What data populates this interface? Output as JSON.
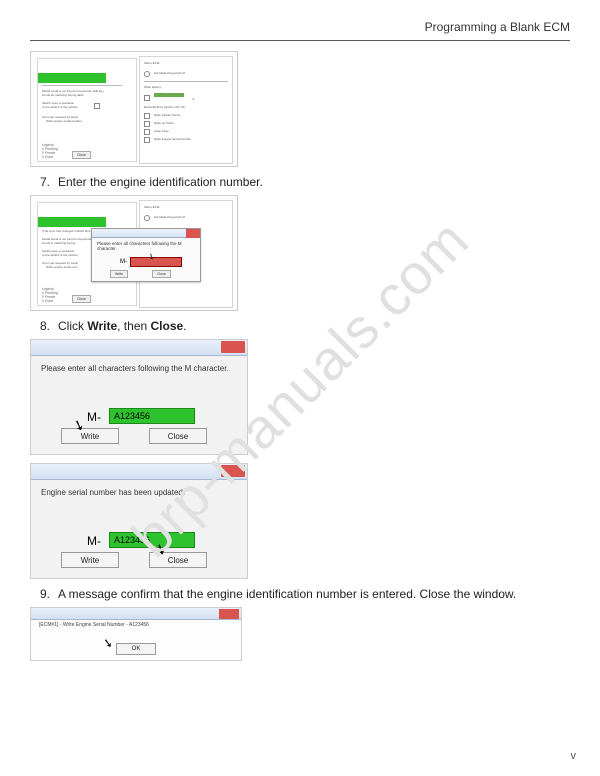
{
  "header": {
    "title": "Programming a Blank ECM"
  },
  "watermark": "brp-manuals.com",
  "page_number": "v",
  "steps": {
    "s7": {
      "num": "7.",
      "text_before": "Enter the engine identification number."
    },
    "s8": {
      "num": "8.",
      "text_prefix": "Click ",
      "bold1": "Write",
      "mid": ", then ",
      "bold2": "Close",
      "suffix": "."
    },
    "s9": {
      "num": "9.",
      "text": "A message confirm that the engine identification number is entered. Close the window."
    }
  },
  "dialog2": {
    "instruction": "Please enter all characters following the M character.",
    "m_label": "M-"
  },
  "dialog3": {
    "instruction": "Please enter all characters following the M character.",
    "m_label": "M-",
    "value": "A123456",
    "write_btn": "Write",
    "close_btn": "Close"
  },
  "dialog4": {
    "message": "Engine serial number has been updated.",
    "m_label": "M-",
    "value": "A123456",
    "write_btn": "Write",
    "close_btn": "Close"
  },
  "dialog5": {
    "title": "[ECM#1] - Write Engine Serial Number - A123456",
    "ok_btn": "OK"
  },
  "legend": {
    "l1": "Legend",
    "l2": "0 Pending",
    "l3": "0 Preset",
    "l4": "0 Done",
    "close": "Close"
  }
}
